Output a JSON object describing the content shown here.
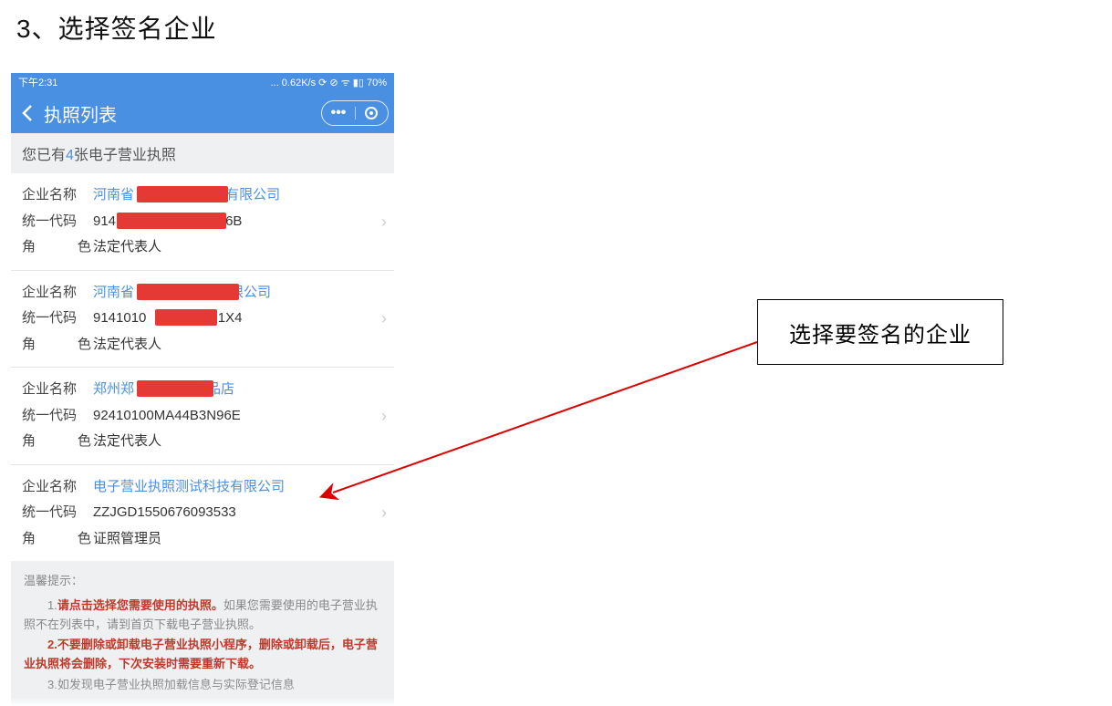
{
  "doc": {
    "heading": "3、选择签名企业"
  },
  "status": {
    "time": "下午2:31",
    "right": "... 0.62K/s ⟳ ⊘ ᯤ ▮▯ 70%"
  },
  "nav": {
    "title": "执照列表"
  },
  "count": {
    "prefix": "您已有",
    "num": "4",
    "suffix": "张电子营业执照"
  },
  "labels": {
    "name": "企业名称",
    "code": "统一代码",
    "role_a": "角",
    "role_b": "色"
  },
  "items": [
    {
      "name_pre": "河南省",
      "name_post": "咨询有限公司",
      "code_pre": "914",
      "code_post": "CF3G6B",
      "role": "法定代表人",
      "redact_name": true,
      "redact_code": true
    },
    {
      "name_pre": "河南省",
      "name_post": "服务有限公司",
      "code_pre": "9141010",
      "code_post": "4B3Q1X4",
      "role": "法定代表人",
      "redact_name": true,
      "redact_code": true
    },
    {
      "name_pre": "郑州郑",
      "name_post": "瀚食品店",
      "code_pre": "92410100MA44B3N96E",
      "code_post": "",
      "role": "法定代表人",
      "redact_name": true,
      "redact_code": false
    },
    {
      "name_pre": "电子营业执照测试科技有限公司",
      "name_post": "",
      "code_pre": "ZZJGD1550676093533",
      "code_post": "",
      "role": "证照管理员",
      "redact_name": false,
      "redact_code": false
    }
  ],
  "tips": {
    "title": "温馨提示：",
    "l1a": "1.",
    "l1b": "请点击选择您需要使用的执照。",
    "l1c": "如果您需要使用的电子营业执照不在列表中，请到首页下载电子营业执照。",
    "l2a": "2.",
    "l2b": "不要删除或卸载电子营业执照小程序，删除或卸载后，电子营业执照将会删除，下次安装时需要重新下载。",
    "l3": "3.如发现电子营业执照加载信息与实际登记信息"
  },
  "annotation": {
    "text": "选择要签名的企业"
  }
}
